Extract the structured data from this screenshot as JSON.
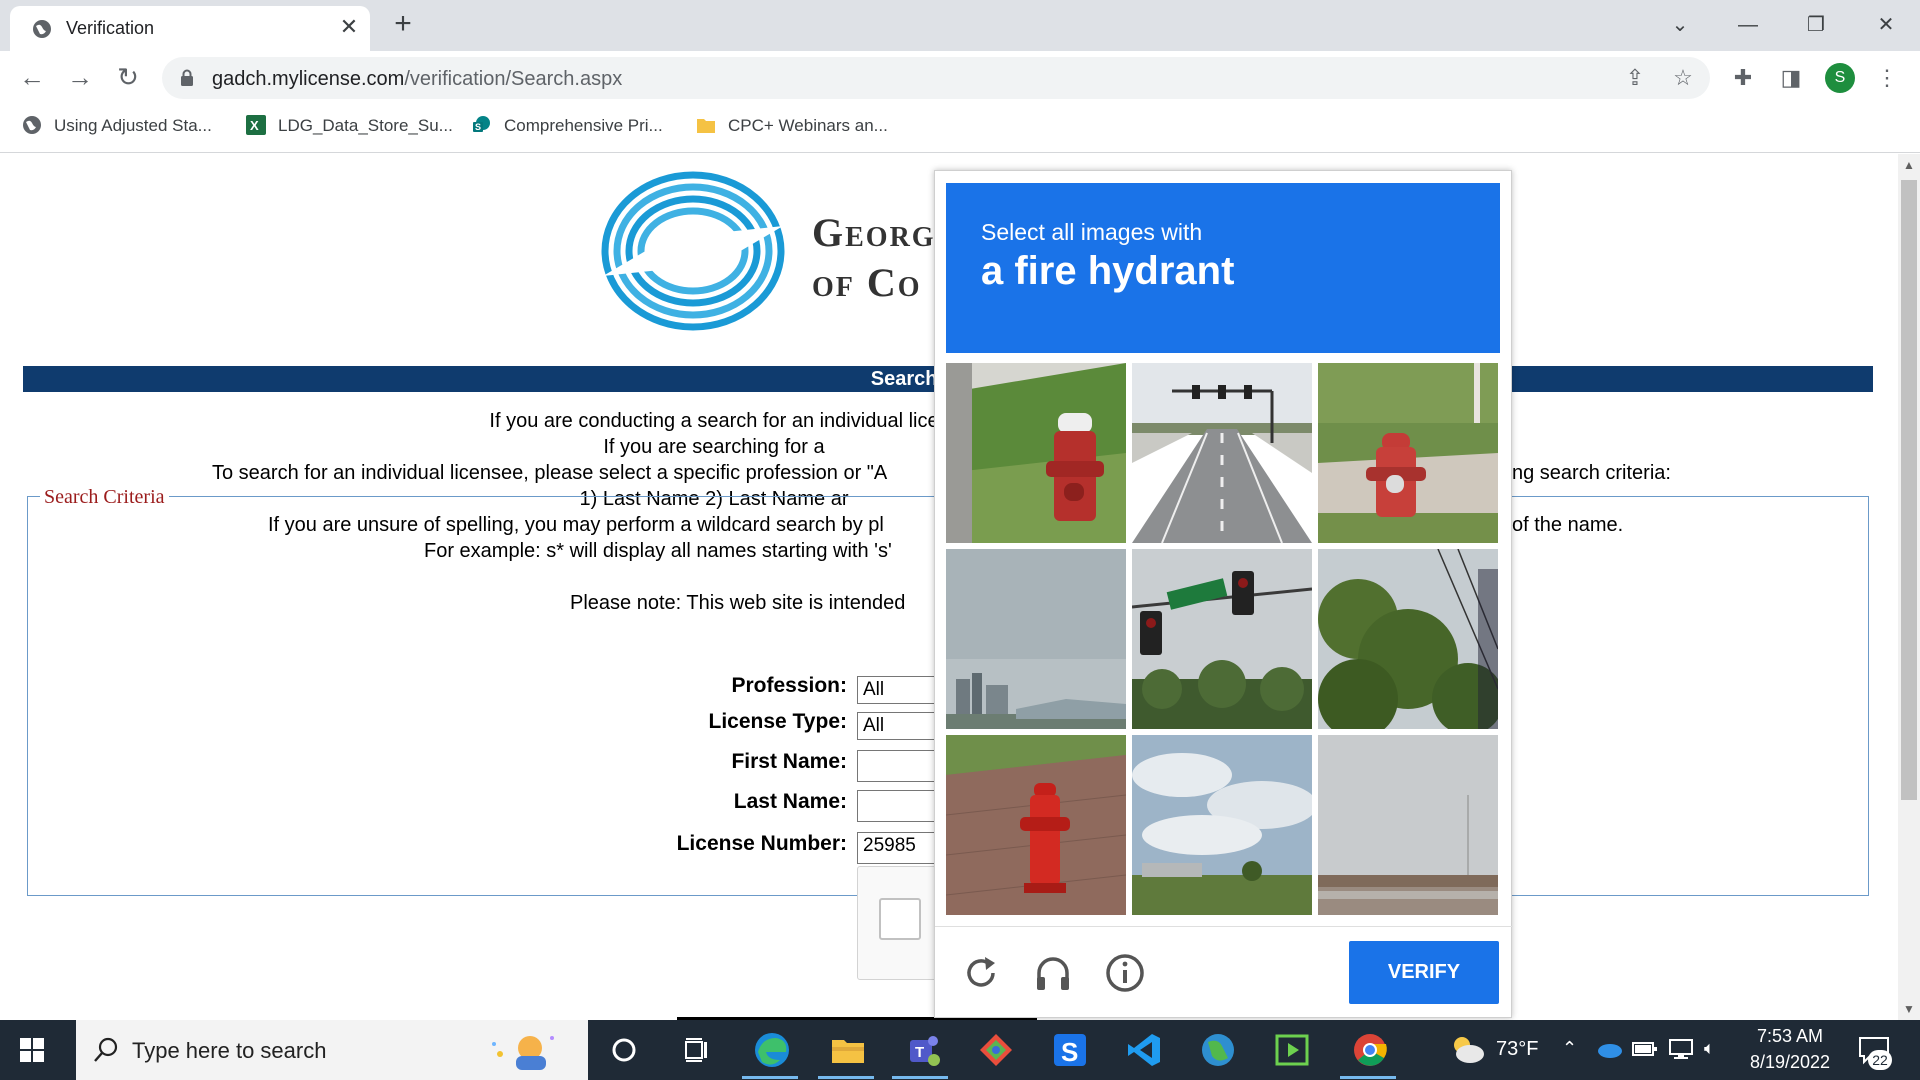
{
  "browser": {
    "tab_title": "Verification",
    "url_host": "gadch.mylicense.com",
    "url_path": "/verification/Search.aspx",
    "profile_initial": "S",
    "bookmarks": [
      {
        "label": "Using Adjusted Sta..."
      },
      {
        "label": "LDG_Data_Store_Su..."
      },
      {
        "label": "Comprehensive Pri..."
      },
      {
        "label": "CPC+ Webinars an..."
      }
    ]
  },
  "page": {
    "org_name_line1": "Georg",
    "org_name_line2": "of Co",
    "search_bar_title": "Search for a Pro",
    "info_lines": [
      "If you are conducting a search for an individual lice",
      "If you are searching for a",
      "To search for an individual licensee, please select a specific profession or \"A",
      "ng search criteria:",
      "1) Last Name 2) Last Name ar",
      "If you are unsure of spelling, you may perform a wildcard search by pl",
      "of the name.",
      "For example: s* will display all names starting with 's'",
      "Please note: This web site is intended"
    ],
    "criteria_legend": "Search Criteria",
    "fields": {
      "profession_label": "Profession:",
      "profession_value": "All",
      "license_type_label": "License Type:",
      "license_type_value": "All",
      "first_name_label": "First Name:",
      "first_name_value": "",
      "last_name_label": "Last Name:",
      "last_name_value": "",
      "license_number_label": "License Number:",
      "license_number_value": "25985"
    }
  },
  "captcha": {
    "prompt_line1": "Select all images with",
    "prompt_line2": "a fire hydrant",
    "verify_label": "VERIFY",
    "tiles": [
      {
        "content": "fire hydrant"
      },
      {
        "content": "road"
      },
      {
        "content": "fire hydrant"
      },
      {
        "content": "city skyline"
      },
      {
        "content": "traffic lights"
      },
      {
        "content": "trees"
      },
      {
        "content": "fire hydrant"
      },
      {
        "content": "sky field"
      },
      {
        "content": "building"
      }
    ],
    "accent_color": "#1a73e8"
  },
  "taskbar": {
    "search_placeholder": "Type here to search",
    "weather": "73°F",
    "time": "7:53 AM",
    "date": "8/19/2022",
    "notification_count": "22"
  }
}
